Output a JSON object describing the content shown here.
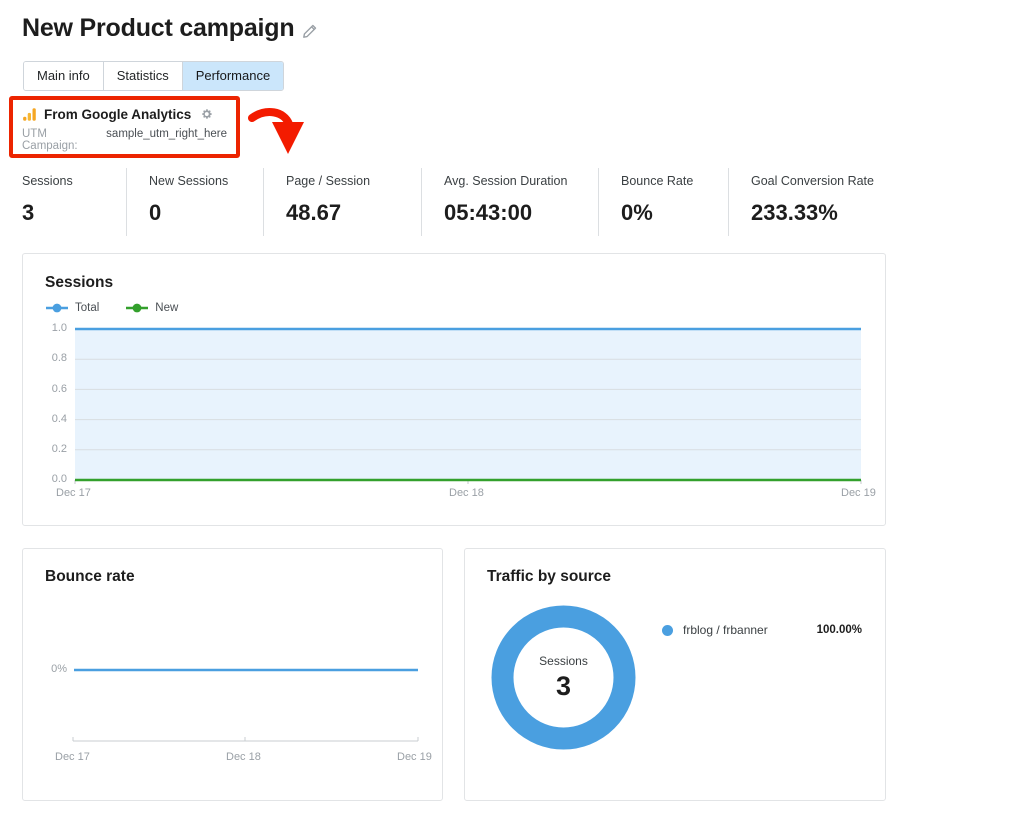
{
  "header": {
    "title": "New Product campaign",
    "edit_icon": "pencil-icon"
  },
  "tabs": [
    {
      "label": "Main info",
      "active": false
    },
    {
      "label": "Statistics",
      "active": false
    },
    {
      "label": "Performance",
      "active": true
    }
  ],
  "source": {
    "icon": "google-analytics-icon",
    "name": "From Google Analytics",
    "settings_icon": "gear-icon",
    "utm_label": "UTM Campaign:",
    "utm_value": "sample_utm_right_here",
    "highlight_color": "#ec2400"
  },
  "annotation": {
    "arrow_icon": "curved-arrow-down-icon",
    "arrow_color": "#ec2400"
  },
  "metrics": [
    {
      "label": "Sessions",
      "value": "3"
    },
    {
      "label": "New Sessions",
      "value": "0"
    },
    {
      "label": "Page / Session",
      "value": "48.67"
    },
    {
      "label": "Avg. Session Duration",
      "value": "05:43:00"
    },
    {
      "label": "Bounce Rate",
      "value": "0%"
    },
    {
      "label": "Goal Conversion Rate",
      "value": "233.33%"
    }
  ],
  "cards": {
    "sessions": {
      "title": "Sessions"
    },
    "bounce": {
      "title": "Bounce rate"
    },
    "traffic": {
      "title": "Traffic by source"
    }
  },
  "traffic": {
    "donut_label": "Sessions",
    "donut_value": "3",
    "legend": [
      {
        "name": "frblog / frbanner",
        "percent": "100.00%",
        "color": "#4a9fe0"
      }
    ]
  },
  "colors": {
    "total_line": "#4a9fe0",
    "total_fill": "#e8f3fd",
    "new_line": "#33a02c",
    "bounce_line": "#4a9fe0",
    "grid": "#d8dde1",
    "axis_text": "#9aa0a6"
  },
  "chart_data": [
    {
      "type": "area",
      "name": "sessions-chart",
      "title": "Sessions",
      "x": [
        "Dec 17",
        "Dec 18",
        "Dec 19"
      ],
      "xlabel": "",
      "ylabel": "",
      "ylim": [
        0.0,
        1.0
      ],
      "yticks": [
        "0.0",
        "0.2",
        "0.4",
        "0.6",
        "0.8",
        "1.0"
      ],
      "grid": true,
      "legend": [
        "Total",
        "New"
      ],
      "legend_position": "top-left",
      "series": [
        {
          "name": "Total",
          "values": [
            1.0,
            1.0,
            1.0
          ],
          "color": "#4a9fe0",
          "fill": "#e8f3fd"
        },
        {
          "name": "New",
          "values": [
            0.0,
            0.0,
            0.0
          ],
          "color": "#33a02c",
          "fill": "none"
        }
      ]
    },
    {
      "type": "line",
      "name": "bounce-rate-chart",
      "title": "Bounce rate",
      "x": [
        "Dec 17",
        "Dec 18",
        "Dec 19"
      ],
      "xlabel": "",
      "ylabel": "",
      "yticks": [
        "0%"
      ],
      "grid": false,
      "series": [
        {
          "name": "Bounce rate",
          "values": [
            0,
            0,
            0
          ],
          "color": "#4a9fe0"
        }
      ]
    },
    {
      "type": "pie",
      "name": "traffic-by-source-chart",
      "title": "Traffic by source",
      "center_label": "Sessions",
      "center_value": "3",
      "labels": [
        "frblog / frbanner"
      ],
      "values": [
        100.0
      ],
      "value_labels": [
        "100.00%"
      ],
      "colors": [
        "#4a9fe0"
      ],
      "legend_position": "right"
    }
  ]
}
